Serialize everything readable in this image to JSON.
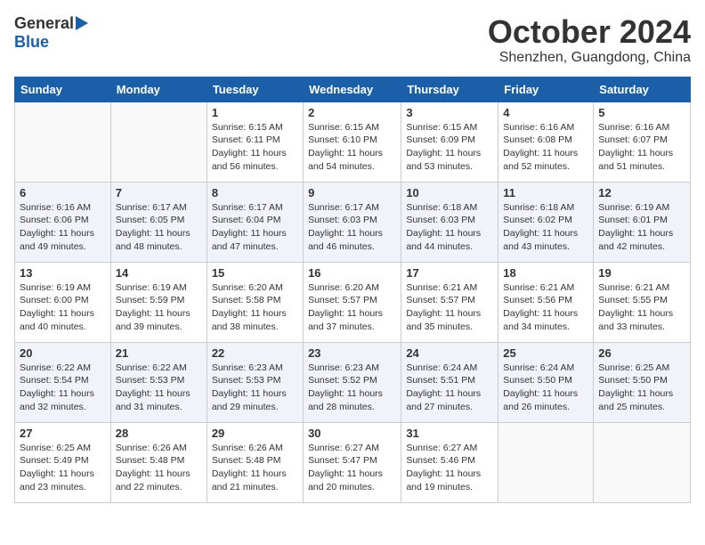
{
  "logo": {
    "general": "General",
    "blue": "Blue"
  },
  "title": {
    "month": "October 2024",
    "location": "Shenzhen, Guangdong, China"
  },
  "weekdays": [
    "Sunday",
    "Monday",
    "Tuesday",
    "Wednesday",
    "Thursday",
    "Friday",
    "Saturday"
  ],
  "weeks": [
    [
      {
        "day": "",
        "info": ""
      },
      {
        "day": "",
        "info": ""
      },
      {
        "day": "1",
        "info": "Sunrise: 6:15 AM\nSunset: 6:11 PM\nDaylight: 11 hours and 56 minutes."
      },
      {
        "day": "2",
        "info": "Sunrise: 6:15 AM\nSunset: 6:10 PM\nDaylight: 11 hours and 54 minutes."
      },
      {
        "day": "3",
        "info": "Sunrise: 6:15 AM\nSunset: 6:09 PM\nDaylight: 11 hours and 53 minutes."
      },
      {
        "day": "4",
        "info": "Sunrise: 6:16 AM\nSunset: 6:08 PM\nDaylight: 11 hours and 52 minutes."
      },
      {
        "day": "5",
        "info": "Sunrise: 6:16 AM\nSunset: 6:07 PM\nDaylight: 11 hours and 51 minutes."
      }
    ],
    [
      {
        "day": "6",
        "info": "Sunrise: 6:16 AM\nSunset: 6:06 PM\nDaylight: 11 hours and 49 minutes."
      },
      {
        "day": "7",
        "info": "Sunrise: 6:17 AM\nSunset: 6:05 PM\nDaylight: 11 hours and 48 minutes."
      },
      {
        "day": "8",
        "info": "Sunrise: 6:17 AM\nSunset: 6:04 PM\nDaylight: 11 hours and 47 minutes."
      },
      {
        "day": "9",
        "info": "Sunrise: 6:17 AM\nSunset: 6:03 PM\nDaylight: 11 hours and 46 minutes."
      },
      {
        "day": "10",
        "info": "Sunrise: 6:18 AM\nSunset: 6:03 PM\nDaylight: 11 hours and 44 minutes."
      },
      {
        "day": "11",
        "info": "Sunrise: 6:18 AM\nSunset: 6:02 PM\nDaylight: 11 hours and 43 minutes."
      },
      {
        "day": "12",
        "info": "Sunrise: 6:19 AM\nSunset: 6:01 PM\nDaylight: 11 hours and 42 minutes."
      }
    ],
    [
      {
        "day": "13",
        "info": "Sunrise: 6:19 AM\nSunset: 6:00 PM\nDaylight: 11 hours and 40 minutes."
      },
      {
        "day": "14",
        "info": "Sunrise: 6:19 AM\nSunset: 5:59 PM\nDaylight: 11 hours and 39 minutes."
      },
      {
        "day": "15",
        "info": "Sunrise: 6:20 AM\nSunset: 5:58 PM\nDaylight: 11 hours and 38 minutes."
      },
      {
        "day": "16",
        "info": "Sunrise: 6:20 AM\nSunset: 5:57 PM\nDaylight: 11 hours and 37 minutes."
      },
      {
        "day": "17",
        "info": "Sunrise: 6:21 AM\nSunset: 5:57 PM\nDaylight: 11 hours and 35 minutes."
      },
      {
        "day": "18",
        "info": "Sunrise: 6:21 AM\nSunset: 5:56 PM\nDaylight: 11 hours and 34 minutes."
      },
      {
        "day": "19",
        "info": "Sunrise: 6:21 AM\nSunset: 5:55 PM\nDaylight: 11 hours and 33 minutes."
      }
    ],
    [
      {
        "day": "20",
        "info": "Sunrise: 6:22 AM\nSunset: 5:54 PM\nDaylight: 11 hours and 32 minutes."
      },
      {
        "day": "21",
        "info": "Sunrise: 6:22 AM\nSunset: 5:53 PM\nDaylight: 11 hours and 31 minutes."
      },
      {
        "day": "22",
        "info": "Sunrise: 6:23 AM\nSunset: 5:53 PM\nDaylight: 11 hours and 29 minutes."
      },
      {
        "day": "23",
        "info": "Sunrise: 6:23 AM\nSunset: 5:52 PM\nDaylight: 11 hours and 28 minutes."
      },
      {
        "day": "24",
        "info": "Sunrise: 6:24 AM\nSunset: 5:51 PM\nDaylight: 11 hours and 27 minutes."
      },
      {
        "day": "25",
        "info": "Sunrise: 6:24 AM\nSunset: 5:50 PM\nDaylight: 11 hours and 26 minutes."
      },
      {
        "day": "26",
        "info": "Sunrise: 6:25 AM\nSunset: 5:50 PM\nDaylight: 11 hours and 25 minutes."
      }
    ],
    [
      {
        "day": "27",
        "info": "Sunrise: 6:25 AM\nSunset: 5:49 PM\nDaylight: 11 hours and 23 minutes."
      },
      {
        "day": "28",
        "info": "Sunrise: 6:26 AM\nSunset: 5:48 PM\nDaylight: 11 hours and 22 minutes."
      },
      {
        "day": "29",
        "info": "Sunrise: 6:26 AM\nSunset: 5:48 PM\nDaylight: 11 hours and 21 minutes."
      },
      {
        "day": "30",
        "info": "Sunrise: 6:27 AM\nSunset: 5:47 PM\nDaylight: 11 hours and 20 minutes."
      },
      {
        "day": "31",
        "info": "Sunrise: 6:27 AM\nSunset: 5:46 PM\nDaylight: 11 hours and 19 minutes."
      },
      {
        "day": "",
        "info": ""
      },
      {
        "day": "",
        "info": ""
      }
    ]
  ]
}
